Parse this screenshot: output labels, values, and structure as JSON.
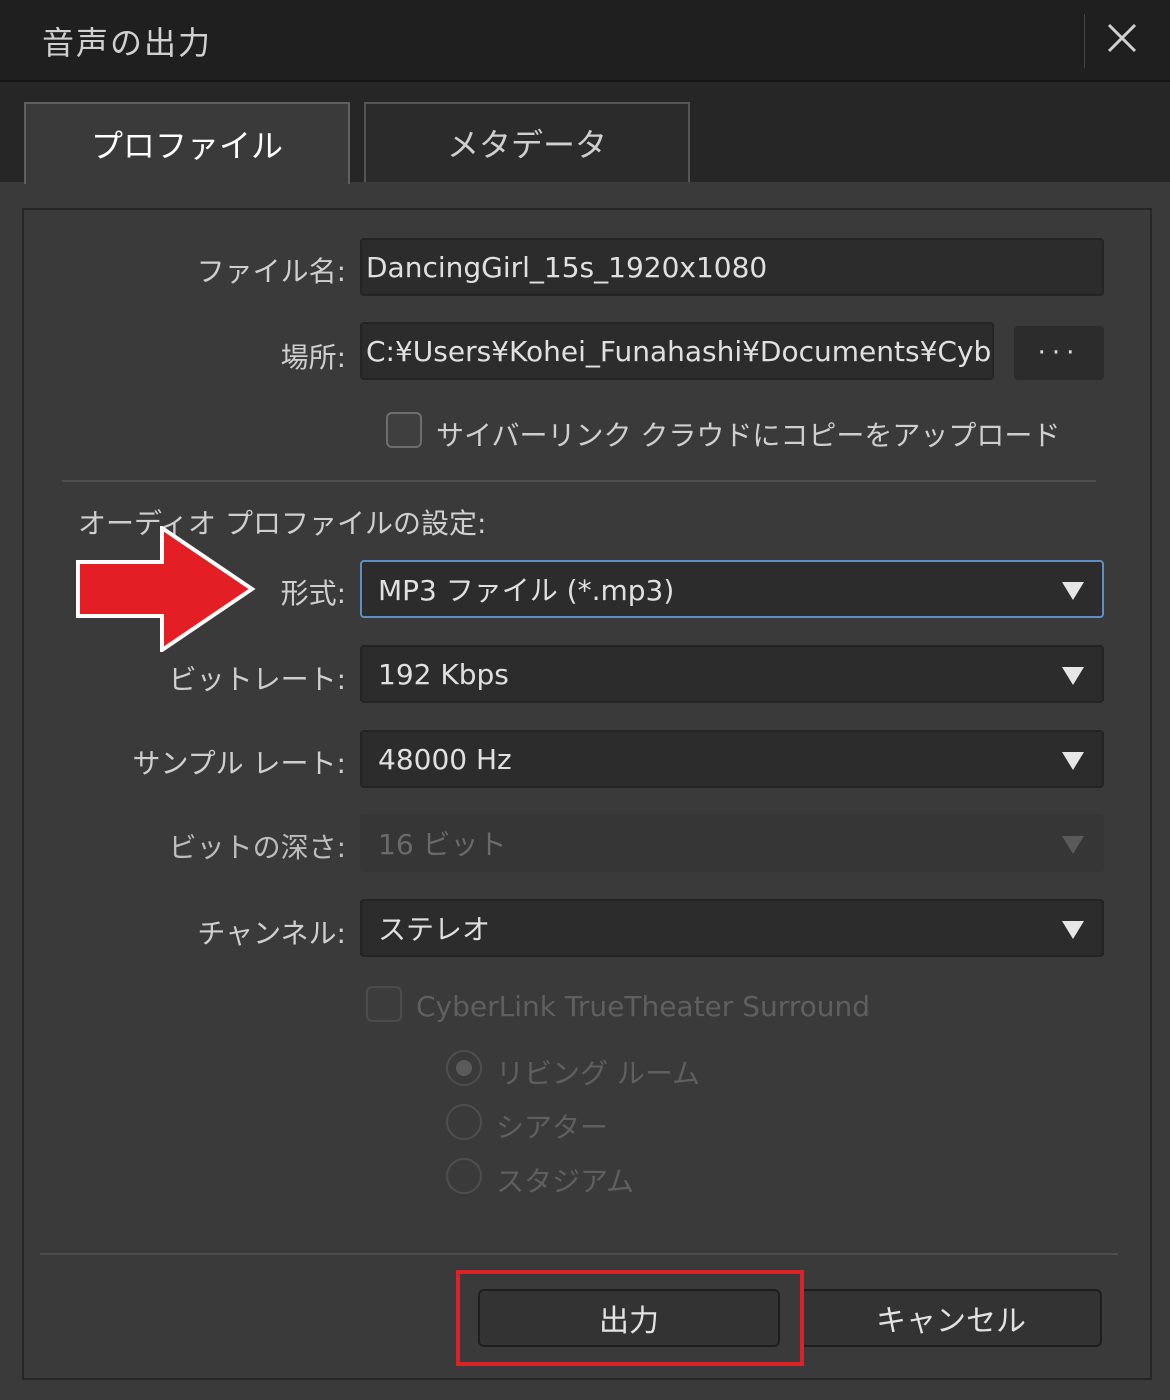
{
  "window": {
    "title": "音声の出力"
  },
  "tabs": [
    {
      "label": "プロファイル",
      "active": true
    },
    {
      "label": "メタデータ",
      "active": false
    }
  ],
  "file": {
    "name_label": "ファイル名:",
    "name_value": "DancingGirl_15s_1920x1080",
    "location_label": "場所:",
    "location_value": "C:¥Users¥Kohei_Funahashi¥Documents¥Cybe...",
    "browse_label": "···",
    "cloud_upload_label": "サイバーリンク クラウドにコピーをアップロード",
    "cloud_upload_checked": false
  },
  "audio": {
    "section_title": "オーディオ プロファイルの設定:",
    "format_label": "形式:",
    "format_value": "MP3 ファイル (*.mp3)",
    "bitrate_label": "ビットレート:",
    "bitrate_value": "192 Kbps",
    "samplerate_label": "サンプル レート:",
    "samplerate_value": "48000 Hz",
    "bitdepth_label": "ビットの深さ:",
    "bitdepth_value": "16 ビット",
    "channel_label": "チャンネル:",
    "channel_value": "ステレオ",
    "surround_label": "CyberLink TrueTheater Surround",
    "surround_checked": false,
    "surround_modes": [
      {
        "label": "リビング ルーム",
        "selected": true
      },
      {
        "label": "シアター",
        "selected": false
      },
      {
        "label": "スタジアム",
        "selected": false
      }
    ]
  },
  "actions": {
    "output_label": "出力",
    "cancel_label": "キャンセル"
  },
  "colors": {
    "annotation_red": "#e31e24",
    "focus_blue": "#5c8fc4"
  },
  "annotations": {
    "arrow_icon": "red-arrow-right-icon",
    "highlight_target": "output-button"
  }
}
